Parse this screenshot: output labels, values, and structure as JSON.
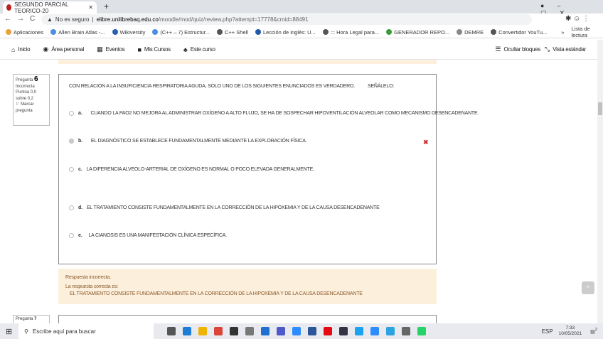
{
  "browser": {
    "tab_title": "SEGUNDO PARCIAL TEORICO-20",
    "insecure": "No es seguro",
    "url_domain": "elibre.unilibrebaq.edu.co",
    "url_path": "/moodle/mod/quiz/review.php?attempt=17778&cmid=88491",
    "bookmarks": [
      "Aplicaciones",
      "Allen Brain Atlas -...",
      "Wikiversity",
      "(C++ – 7) Estructur...",
      "C++ Shell",
      "Lección de inglés: U...",
      "::: Hora Legal para...",
      "GENERADOR REPO...",
      "DEMRE",
      "Convertidor YouTu..."
    ],
    "reading_list": "Lista de lectura",
    "more": "»"
  },
  "nav": {
    "items": [
      "Inicio",
      "Área personal",
      "Eventos",
      "Mis Cursos",
      "Este curso"
    ],
    "hide_blocks": "Ocultar bloques",
    "standard_view": "Vista estándar"
  },
  "question": {
    "label": "Pregunta",
    "number": "6",
    "status": "Incorrecta",
    "score": "Puntúa 0,0 sobre 0,2",
    "flag": "Marcar pregunta",
    "text": "CON RELACIÓN A LA INSUFICIENCIA RESPIRATORIA AGUDA, SÓLO UNO DE LOS SIGUIENTES ENUNCIADOS ES VERDADERO.",
    "instruction": "SEÑÁLELO:",
    "options": [
      {
        "letter": "a.",
        "text": "CUANDO LA PAO2 NO MEJORA AL ADMINISTRAR OXÍGENO A ALTO FLUJO, SE HA DE SOSPECHAR HIPOVENTILACIÓN ALVEOLAR COMO MECANISMO DESENCADENANTE."
      },
      {
        "letter": "b.",
        "text": "EL DIAGNÓSTICO SE ESTABLECE FUNDAMENTALMENTE MEDIANTE LA EXPLORACIÓN FÍSICA.",
        "selected": true
      },
      {
        "letter": "c.",
        "text": "LA DIFERENCIA ALVEOLO-ARTERIAL DE OXÍGENO ES NORMAL O POCO ELEVADA GENERALMENTE."
      },
      {
        "letter": "d.",
        "text": "EL TRATAMIENTO CONSISTE FUNDAMENTALMENTE EN LA CORRECCIÓN DE LA HIPOXEMIA Y DE LA CAUSA DESENCADENANTE"
      },
      {
        "letter": "e.",
        "text": "LA CIANOSIS ES UNA MANIFESTACIÓN CLÍNICA ESPECÍFICA."
      }
    ]
  },
  "feedback": {
    "result": "Respuesta incorrecta.",
    "correct_label": "La respuesta correcta es:",
    "correct_answer": "EL TRATAMIENTO CONSISTE FUNDAMENTALMENTE EN LA CORRECCIÓN DE LA HIPOXEMIA Y DE LA CAUSA DESENCADENANTE"
  },
  "next_question": {
    "label": "Pregunta",
    "number": "7"
  },
  "taskbar": {
    "search_placeholder": "Escribe aquí para buscar",
    "lang": "ESP",
    "time": "7:33",
    "date": "10/05/2021",
    "notifications": "2"
  }
}
